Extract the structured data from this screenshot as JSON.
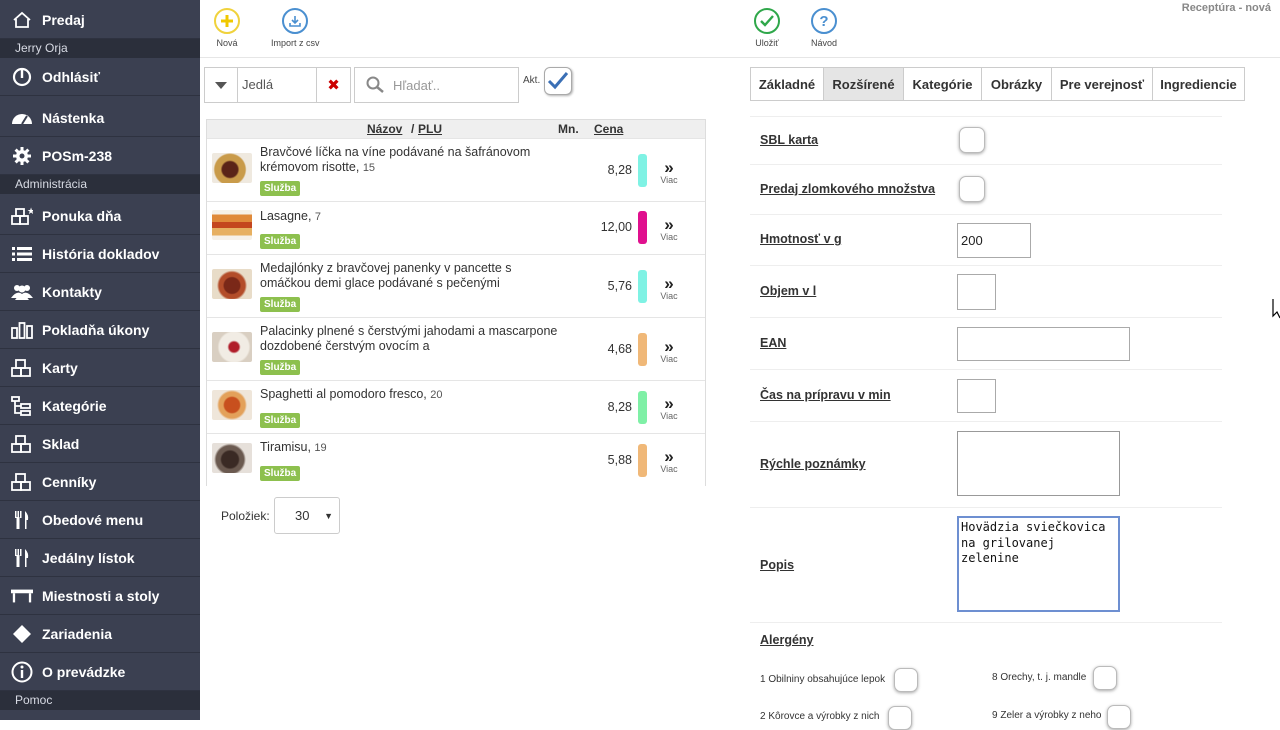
{
  "sidebar": {
    "items": [
      {
        "label": "Predaj",
        "icon": "home-icon"
      },
      {
        "label": "Odhlásiť",
        "icon": "power-icon"
      },
      {
        "label": "Nástenka",
        "icon": "dashboard-icon"
      },
      {
        "label": "POSm-238",
        "icon": "gear-icon"
      },
      {
        "label": "Ponuka dňa",
        "icon": "blocks-star-icon"
      },
      {
        "label": "História dokladov",
        "icon": "list-icon"
      },
      {
        "label": "Kontakty",
        "icon": "users-icon"
      },
      {
        "label": "Pokladňa úkony",
        "icon": "bar-chart-icon"
      },
      {
        "label": "Karty",
        "icon": "blocks-icon"
      },
      {
        "label": "Kategórie",
        "icon": "tree-icon"
      },
      {
        "label": "Sklad",
        "icon": "blocks-icon"
      },
      {
        "label": "Cenníky",
        "icon": "blocks-icon"
      },
      {
        "label": "Obedové menu",
        "icon": "fork-knife-icon"
      },
      {
        "label": "Jedálny lístok",
        "icon": "fork-knife-icon"
      },
      {
        "label": "Miestnosti a stoly",
        "icon": "table-icon"
      },
      {
        "label": "Zariadenia",
        "icon": "diamond-icon"
      },
      {
        "label": "O prevádzke",
        "icon": "info-icon"
      }
    ],
    "sections": {
      "user": "Jerry Orja",
      "admin": "Administrácia",
      "help": "Pomoc"
    }
  },
  "toolbar": {
    "new_label": "Nová",
    "import_label": "Import z csv",
    "save_label": "Uložiť",
    "help_label": "Návod",
    "page_title": "Receptúra - nová"
  },
  "filters": {
    "category": "Jedlá",
    "search_placeholder": "Hľadať..",
    "active_label": "Akt.",
    "active_checked": true
  },
  "table": {
    "headers": {
      "name": "Názov",
      "sep": "/",
      "plu": "PLU",
      "qty": "Mn.",
      "price": "Cena"
    },
    "more_label": "Viac",
    "rows": [
      {
        "name": "Bravčové líčka na víne podávané na šafránovom krémovom risotte",
        "plu": "15",
        "badge": "Služba",
        "price": "8,28",
        "color": "#7ff2e4"
      },
      {
        "name": "Lasagne",
        "plu": "7",
        "badge": "Služba",
        "price": "12,00",
        "color": "#e0108e"
      },
      {
        "name": "Medajlónky z bravčovej panenky v pancette s omáčkou demi glace podávané s pečenými",
        "plu": "",
        "badge": "Služba",
        "price": "5,76",
        "color": "#7ff2e4"
      },
      {
        "name": "Palacinky plnené s čerstvými jahodami a mascarpone dozdobené čerstvým ovocím a",
        "plu": "",
        "badge": "Služba",
        "price": "4,68",
        "color": "#f0b878"
      },
      {
        "name": "Spaghetti al pomodoro fresco",
        "plu": "20",
        "badge": "Služba",
        "price": "8,28",
        "color": "#7ff0a6"
      },
      {
        "name": "Tiramisu",
        "plu": "19",
        "badge": "Služba",
        "price": "5,88",
        "color": "#f0b878"
      }
    ]
  },
  "pagination": {
    "label": "Položiek:",
    "value": "30"
  },
  "tabs": [
    "Základné",
    "Rozšírené",
    "Kategórie",
    "Obrázky",
    "Pre verejnosť",
    "Ingrediencie"
  ],
  "form": {
    "sbl_label": "SBL karta",
    "fraction_label": "Predaj zlomkového množstva",
    "weight_label": "Hmotnosť v g",
    "weight_value": "200",
    "volume_label": "Objem v l",
    "ean_label": "EAN",
    "prep_label": "Čas na prípravu v min",
    "notes_label": "Rýchle poznámky",
    "desc_label": "Popis",
    "desc_value": "Hovädzia sviečkovica\nna grilovanej\nzelenine",
    "allergens_label": "Alergény",
    "allergens": [
      "1 Obilniny obsahujúce lepok",
      "8 Orechy, t. j. mandle",
      "2 Kôrovce a výrobky z nich",
      "9 Zeler a výrobky z neho"
    ]
  }
}
